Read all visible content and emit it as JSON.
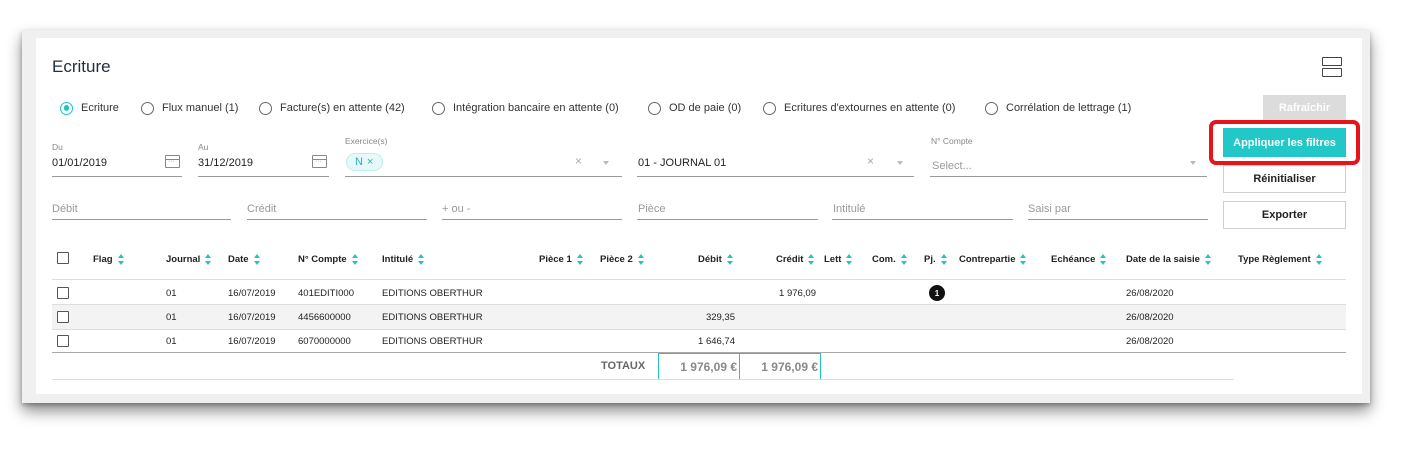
{
  "title": "Ecriture",
  "radios": [
    {
      "label": "Ecriture",
      "selected": true
    },
    {
      "label": "Flux manuel (1)",
      "selected": false
    },
    {
      "label": "Facture(s) en attente (42)",
      "selected": false
    },
    {
      "label": "Intégration bancaire en attente (0)",
      "selected": false
    },
    {
      "label": "OD de paie (0)",
      "selected": false
    },
    {
      "label": "Ecritures d'extournes en attente (0)",
      "selected": false
    },
    {
      "label": "Corrélation de lettrage (1)",
      "selected": false
    }
  ],
  "buttons": {
    "refresh": "Rafraîchir",
    "apply": "Appliquer les filtres",
    "reset": "Réinitialiser",
    "export": "Exporter"
  },
  "filters": {
    "du_label": "Du",
    "du_value": "01/01/2019",
    "au_label": "Au",
    "au_value": "31/12/2019",
    "exercice_label": "Exercice(s)",
    "exercice_chip": "N",
    "journal_value": "01 - JOURNAL 01",
    "compte_label": "N° Compte",
    "compte_placeholder": "Select...",
    "debit_placeholder": "Débit",
    "credit_placeholder": "Crédit",
    "plusmoins_placeholder": "+ ou -",
    "piece_placeholder": "Pièce",
    "intitule_placeholder": "Intitulé",
    "saisi_placeholder": "Saisi par"
  },
  "table": {
    "headers": {
      "flag": "Flag",
      "journal": "Journal",
      "date": "Date",
      "compte": "N° Compte",
      "intitule": "Intitulé",
      "piece1": "Pièce 1",
      "piece2": "Pièce 2",
      "debit": "Débit",
      "credit": "Crédit",
      "lett": "Lett",
      "com": "Com.",
      "pj": "Pj.",
      "contrepartie": "Contrepartie",
      "echeance": "Echéance",
      "date_saisie": "Date de la saisie",
      "type_reglement": "Type Règlement"
    },
    "rows": [
      {
        "journal": "01",
        "date": "16/07/2019",
        "compte": "401EDITI000",
        "intitule": "EDITIONS OBERTHUR",
        "debit": "",
        "credit": "1 976,09",
        "pj": "1",
        "date_saisie": "26/08/2020"
      },
      {
        "journal": "01",
        "date": "16/07/2019",
        "compte": "4456600000",
        "intitule": "EDITIONS OBERTHUR",
        "debit": "329,35",
        "credit": "",
        "pj": "",
        "date_saisie": "26/08/2020"
      },
      {
        "journal": "01",
        "date": "16/07/2019",
        "compte": "6070000000",
        "intitule": "EDITIONS OBERTHUR",
        "debit": "1 646,74",
        "credit": "",
        "pj": "",
        "date_saisie": "26/08/2020"
      }
    ],
    "totals_label": "TOTAUX",
    "total_debit": "1 976,09 €",
    "total_credit": "1 976,09 €"
  },
  "colors": {
    "accent": "#22c7c7",
    "highlight": "#e8141b"
  }
}
